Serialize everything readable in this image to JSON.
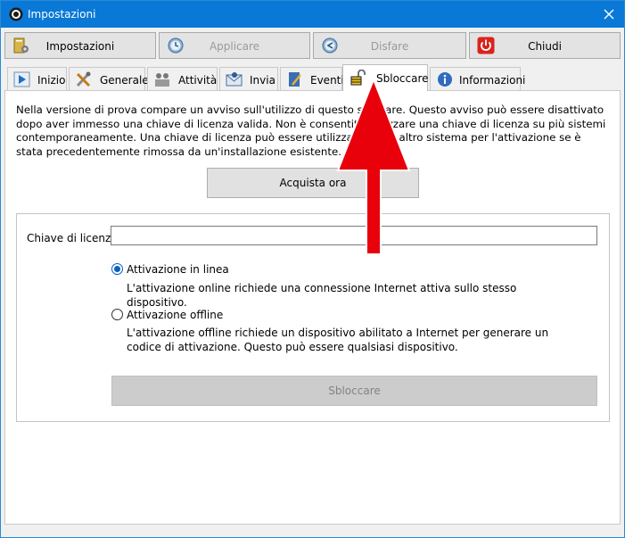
{
  "window": {
    "title": "Impostazioni"
  },
  "toolbar": {
    "settings": "Impostazioni",
    "apply": "Applicare",
    "undo": "Disfare",
    "close": "Chiudi"
  },
  "tabs": [
    {
      "label": "Inizio",
      "icon": "play-icon"
    },
    {
      "label": "Generale",
      "icon": "tools-icon"
    },
    {
      "label": "Attività",
      "icon": "people-icon"
    },
    {
      "label": "Invia",
      "icon": "mail-icon"
    },
    {
      "label": "Eventi",
      "icon": "notebook-icon"
    },
    {
      "label": "Sbloccare",
      "icon": "padlock-icon",
      "active": true
    },
    {
      "label": "Informazioni",
      "icon": "info-icon"
    }
  ],
  "unlock": {
    "intro": "Nella versione di prova compare un avviso sull'utilizzo di questo software. Questo avviso può essere disattivato dopo aver immesso una chiave di licenza valida. Non è consentito utilizzare una chiave di licenza su più sistemi contemporaneamente. Una chiave di licenza può essere utilizzata su un altro sistema per l'attivazione se è stata precedentemente rimossa da un'installazione esistente.",
    "buy_button": "Acquista ora",
    "license_label": "Chiave di licenza:",
    "license_value": "",
    "online_label": "Attivazione in linea",
    "online_desc": "L'attivazione online richiede una connessione Internet attiva sullo stesso dispositivo.",
    "offline_label": "Attivazione offline",
    "offline_desc": "L'attivazione offline richiede un dispositivo abilitato a Internet per generare un codice di attivazione. Questo può essere qualsiasi dispositivo.",
    "selected_mode": "online",
    "unlock_button": "Sbloccare"
  },
  "colors": {
    "titlebar": "#0a78d7",
    "arrow": "#e8000b",
    "close_red": "#d9231d"
  }
}
